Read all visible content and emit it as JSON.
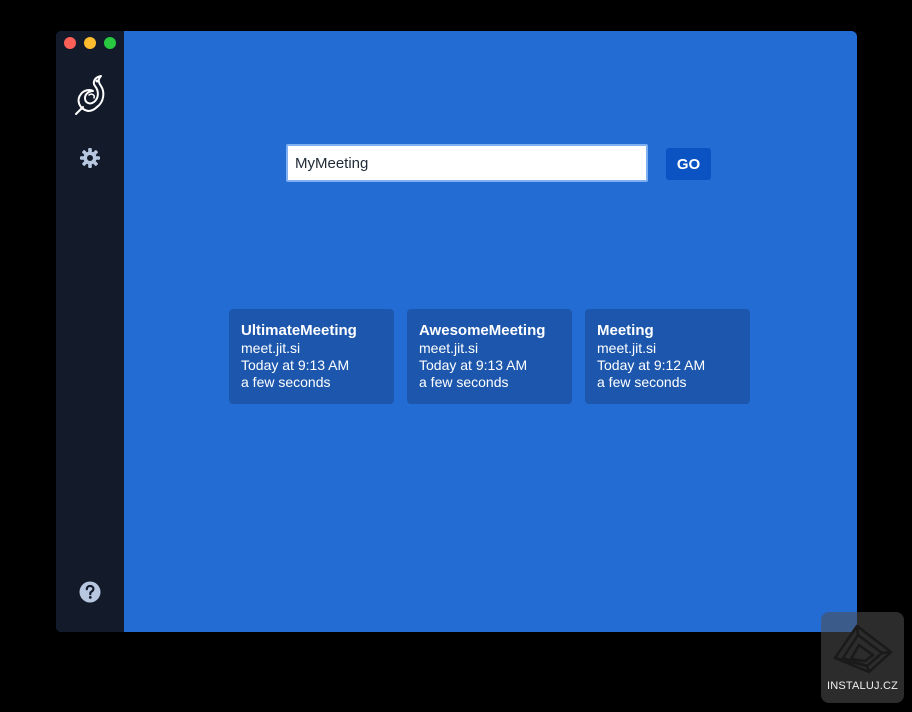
{
  "colors": {
    "main_background": "#236cd3",
    "sidebar_background": "#131b2b",
    "card_background": "#1c57ad",
    "go_button": "#0b52c2",
    "traffic_close": "#fe5f57",
    "traffic_minimize": "#febc2e",
    "traffic_maximize": "#28c840"
  },
  "sidebar": {
    "logo_icon": "jitsi-logo-icon",
    "settings_icon": "gear-icon",
    "help_icon": "help-icon"
  },
  "search": {
    "value": "MyMeeting"
  },
  "go_button": {
    "label": "GO"
  },
  "recent": [
    {
      "title": "UltimateMeeting",
      "server": "meet.jit.si",
      "date": "Today at 9:13 AM",
      "duration": "a few seconds"
    },
    {
      "title": "AwesomeMeeting",
      "server": "meet.jit.si",
      "date": "Today at 9:13 AM",
      "duration": "a few seconds"
    },
    {
      "title": "Meeting",
      "server": "meet.jit.si",
      "date": "Today at 9:12 AM",
      "duration": "a few seconds"
    }
  ],
  "watermark": {
    "text": "INSTALUJ.CZ"
  }
}
